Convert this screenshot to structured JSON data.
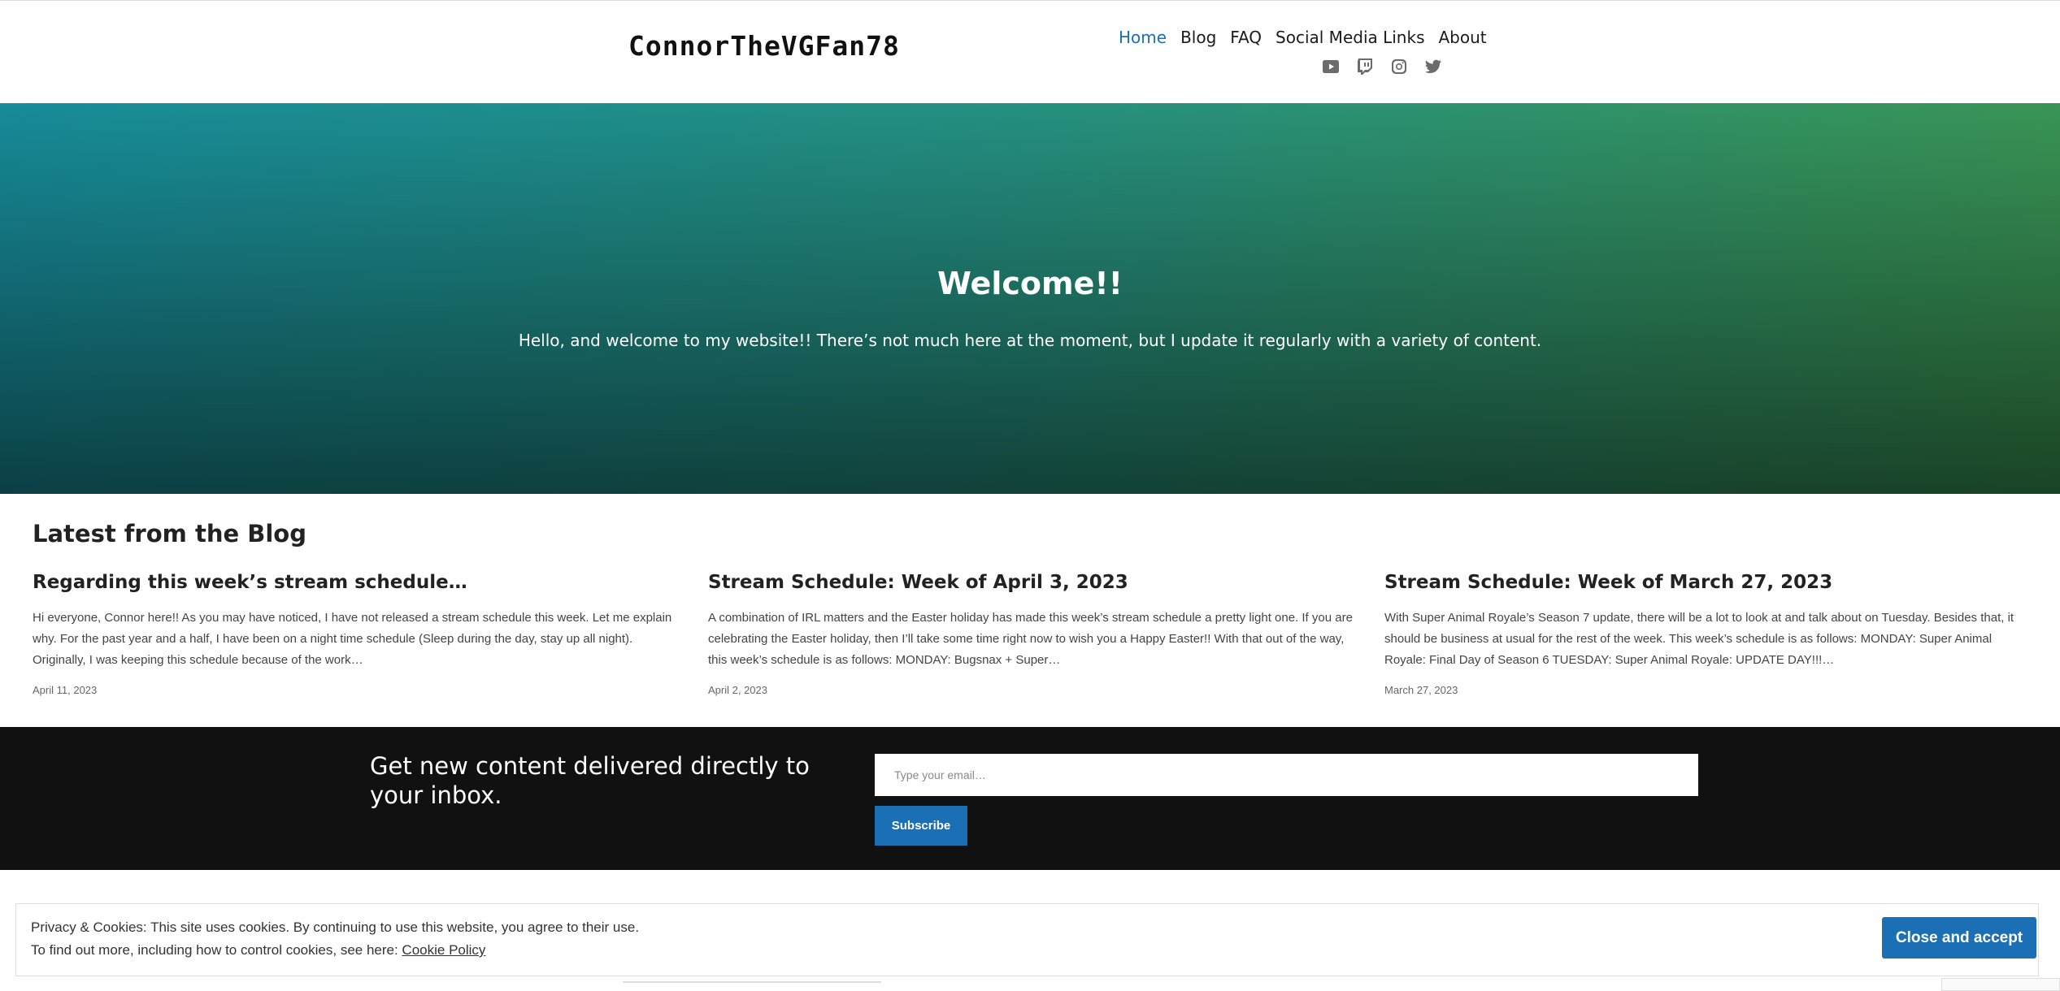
{
  "header": {
    "site_title": "ConnorTheVGFan78",
    "nav": [
      "Home",
      "Blog",
      "FAQ",
      "Social Media Links",
      "About"
    ],
    "social_icons": [
      "youtube-icon",
      "twitch-icon",
      "instagram-icon",
      "twitter-icon"
    ]
  },
  "hero": {
    "title": "Welcome!!",
    "text": "Hello, and welcome to my website!! There’s not much here at the moment, but I update it regularly with a variety of content."
  },
  "blog": {
    "heading": "Latest from the Blog",
    "posts": [
      {
        "title": "Regarding this week’s stream schedule…",
        "excerpt": "Hi everyone, Connor here!! As you may have noticed, I have not released a stream schedule this week. Let me explain why. For the past year and a half, I have been on a night time schedule (Sleep during the day, stay up all night). Originally, I was keeping this schedule because of the work…",
        "date": "April 11, 2023"
      },
      {
        "title": "Stream Schedule: Week of April 3, 2023",
        "excerpt": "A combination of IRL matters and the Easter holiday has made this week’s stream schedule a pretty light one. If you are celebrating the Easter holiday, then I’ll take some time right now to wish you a Happy Easter!! With that out of the way, this week’s schedule is as follows: MONDAY: Bugsnax + Super…",
        "date": "April 2, 2023"
      },
      {
        "title": "Stream Schedule: Week of March 27, 2023",
        "excerpt": "With Super Animal Royale’s Season 7 update, there will be a lot to look at and talk about on Tuesday. Besides that, it should be business at usual for the rest of the week. This week’s schedule is as follows: MONDAY: Super Animal Royale: Final Day of Season 6 TUESDAY: Super Animal Royale: UPDATE DAY!!!…",
        "date": "March 27, 2023"
      }
    ]
  },
  "subscribe": {
    "heading": "Get new content delivered directly to your inbox.",
    "placeholder": "Type your email…",
    "button": "Subscribe"
  },
  "cookie": {
    "line1": "Privacy & Cookies: This site uses cookies. By continuing to use this website, you agree to their use.",
    "line2_prefix": "To find out more, including how to control cookies, see here: ",
    "link": "Cookie Policy",
    "button": "Close and accept"
  },
  "colors": {
    "accent": "#1b6fb5",
    "hero_start": "#178c9a",
    "hero_end": "#3a9553",
    "footer_bg": "#111111"
  }
}
